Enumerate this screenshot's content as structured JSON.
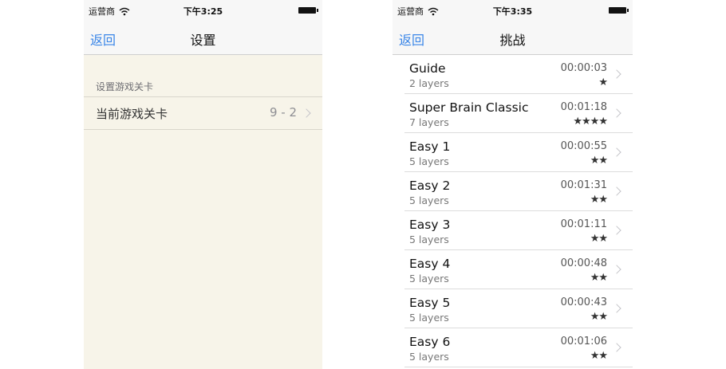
{
  "left": {
    "status": {
      "carrier": "运营商",
      "time": "下午3:25"
    },
    "nav": {
      "back": "返回",
      "title": "设置"
    },
    "section_header": "设置游戏关卡",
    "cell": {
      "label": "当前游戏关卡",
      "value": "9 - 2"
    }
  },
  "right": {
    "status": {
      "carrier": "运营商",
      "time": "下午3:35"
    },
    "nav": {
      "back": "返回",
      "title": "挑战"
    },
    "levels": [
      {
        "name": "Guide",
        "layers": "2 layers",
        "time": "00:00:03",
        "stars": "★"
      },
      {
        "name": "Super Brain Classic",
        "layers": "7 layers",
        "time": "00:01:18",
        "stars": "★★★★"
      },
      {
        "name": "Easy 1",
        "layers": "5 layers",
        "time": "00:00:55",
        "stars": "★★"
      },
      {
        "name": "Easy 2",
        "layers": "5 layers",
        "time": "00:01:31",
        "stars": "★★"
      },
      {
        "name": "Easy 3",
        "layers": "5 layers",
        "time": "00:01:11",
        "stars": "★★"
      },
      {
        "name": "Easy 4",
        "layers": "5 layers",
        "time": "00:00:48",
        "stars": "★★"
      },
      {
        "name": "Easy 5",
        "layers": "5 layers",
        "time": "00:00:43",
        "stars": "★★"
      },
      {
        "name": "Easy 6",
        "layers": "5 layers",
        "time": "00:01:06",
        "stars": "★★"
      }
    ]
  },
  "icons": {
    "wifi": "wifi-icon",
    "battery": "battery-icon",
    "chevron": "chevron-right-icon",
    "star": "star-icon"
  },
  "colors": {
    "accent": "#3a86e8",
    "settings_background": "#f7f4e9"
  }
}
